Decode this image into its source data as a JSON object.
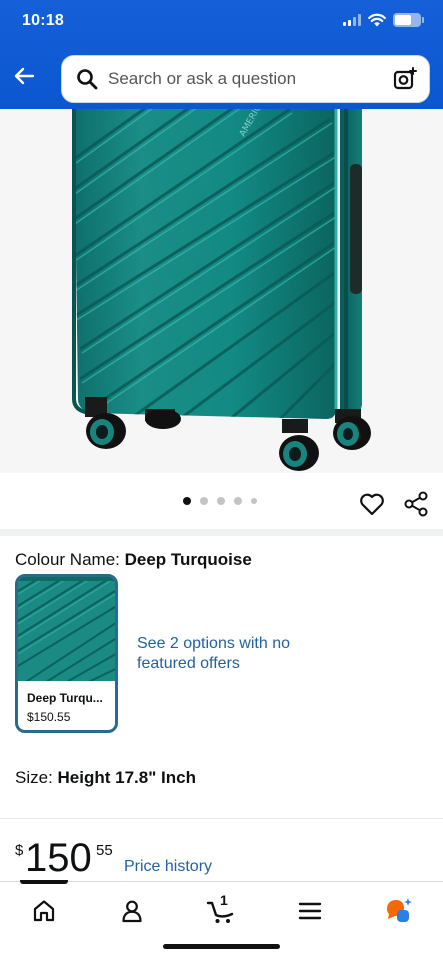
{
  "status_bar": {
    "time": "10:18"
  },
  "search": {
    "placeholder": "Search or ask a question"
  },
  "carousel": {
    "dot_count": 5,
    "active_index": 0
  },
  "colour": {
    "label": "Colour Name: ",
    "value": "Deep Turquoise",
    "swatch": {
      "name": "Deep Turqu...",
      "price": "$150.55"
    },
    "options_link": "See 2 options with no featured offers"
  },
  "size": {
    "label": "Size: ",
    "value": "Height 17.8\" Inch"
  },
  "price": {
    "symbol": "$",
    "whole": "150",
    "fraction": "55",
    "history_link": "Price history"
  },
  "nav": {
    "cart_count": "1"
  },
  "colors": {
    "header_blue": "#0b57d0",
    "link_blue": "#2162a1",
    "luggage_teal": "#138a84",
    "swatch_border": "#2b6a8a"
  },
  "icons": [
    "back-arrow-icon",
    "search-icon",
    "camera-search-icon",
    "heart-icon",
    "share-icon",
    "home-icon",
    "account-icon",
    "cart-icon",
    "menu-icon",
    "rufus-assistant-icon"
  ]
}
